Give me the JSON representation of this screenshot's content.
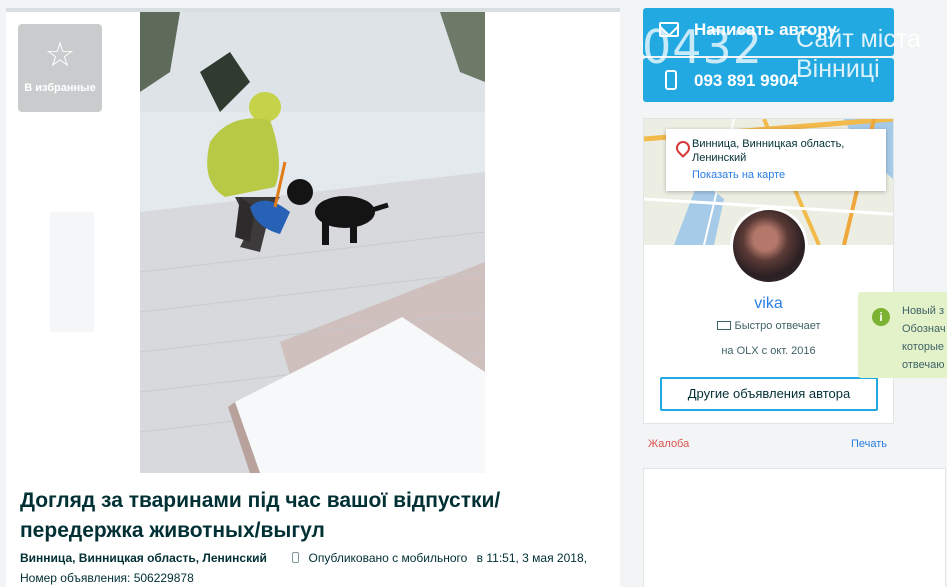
{
  "favorites": {
    "icon": "star-icon",
    "label": "В избранные"
  },
  "listing": {
    "title": "Догляд за тваринами під час вашої відпустки/передержка животных/выгул",
    "location": "Винница, Винницкая область, Ленинский",
    "published_via": "Опубликовано с мобильного",
    "published_at": "в 11:51, 3 мая 2018,",
    "ad_number": "Номер объявления: 506229878"
  },
  "contact": {
    "write_label": "Написать автору",
    "phone": "093 891 9904",
    "accent_color": "#23a9e1"
  },
  "watermark": {
    "number": "0432",
    "text_line1": "Сайт міста",
    "text_line2": "Вінниці"
  },
  "seller": {
    "address": "Винница, Винницкая область, Ленинский",
    "show_on_map": "Показать на карте",
    "name": "vika",
    "fast_reply": "Быстро отвечает",
    "member_since": "на OLX с окт. 2016",
    "other_ads": "Другие объявления автора"
  },
  "tooltip": {
    "lines": [
      "Новый з",
      "Обознач",
      "которые",
      "отвечаю"
    ]
  },
  "actions": {
    "complaint": "Жалоба",
    "print": "Печать"
  }
}
